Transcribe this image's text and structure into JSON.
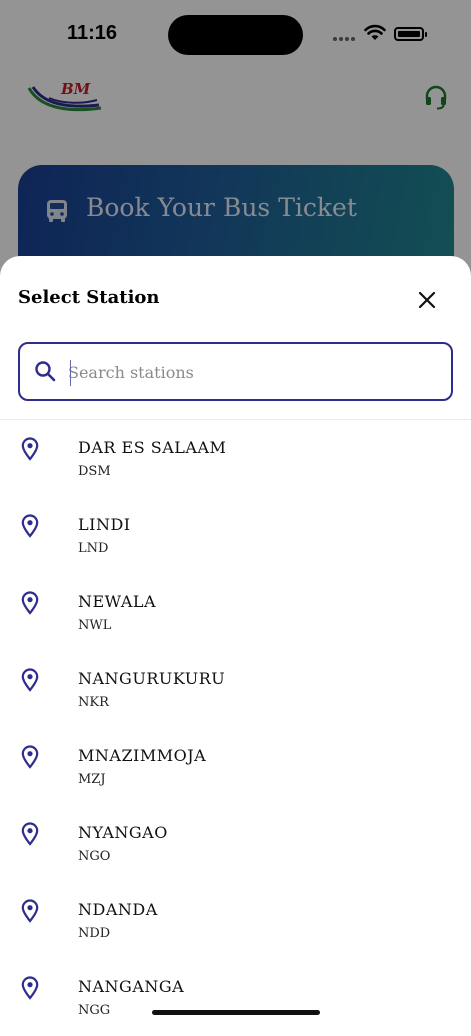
{
  "status": {
    "time": "11:16"
  },
  "hero": {
    "title": "Book Your Bus Ticket"
  },
  "sheet": {
    "title": "Select Station",
    "search": {
      "value": "",
      "placeholder": "Search stations"
    }
  },
  "stations": [
    {
      "name": "DAR ES SALAAM",
      "code": "DSM"
    },
    {
      "name": "LINDI",
      "code": "LND"
    },
    {
      "name": "NEWALA",
      "code": "NWL"
    },
    {
      "name": "NANGURUKURU",
      "code": "NKR"
    },
    {
      "name": "MNAZIMMOJA",
      "code": "MZJ"
    },
    {
      "name": "NYANGAO",
      "code": "NGO"
    },
    {
      "name": "NDANDA",
      "code": "NDD"
    },
    {
      "name": "NANGANGA",
      "code": "NGG"
    }
  ],
  "colors": {
    "accent": "#2e2c8e",
    "pin": "#2e2c8e",
    "support": "#1b7a2e",
    "hero_start": "#1a3f95",
    "hero_end": "#21898f"
  },
  "icons": {
    "logo": "bm-logo",
    "support": "headset-icon",
    "bus": "bus-icon",
    "close": "close-icon",
    "search": "search-icon",
    "station": "map-pin-icon"
  }
}
